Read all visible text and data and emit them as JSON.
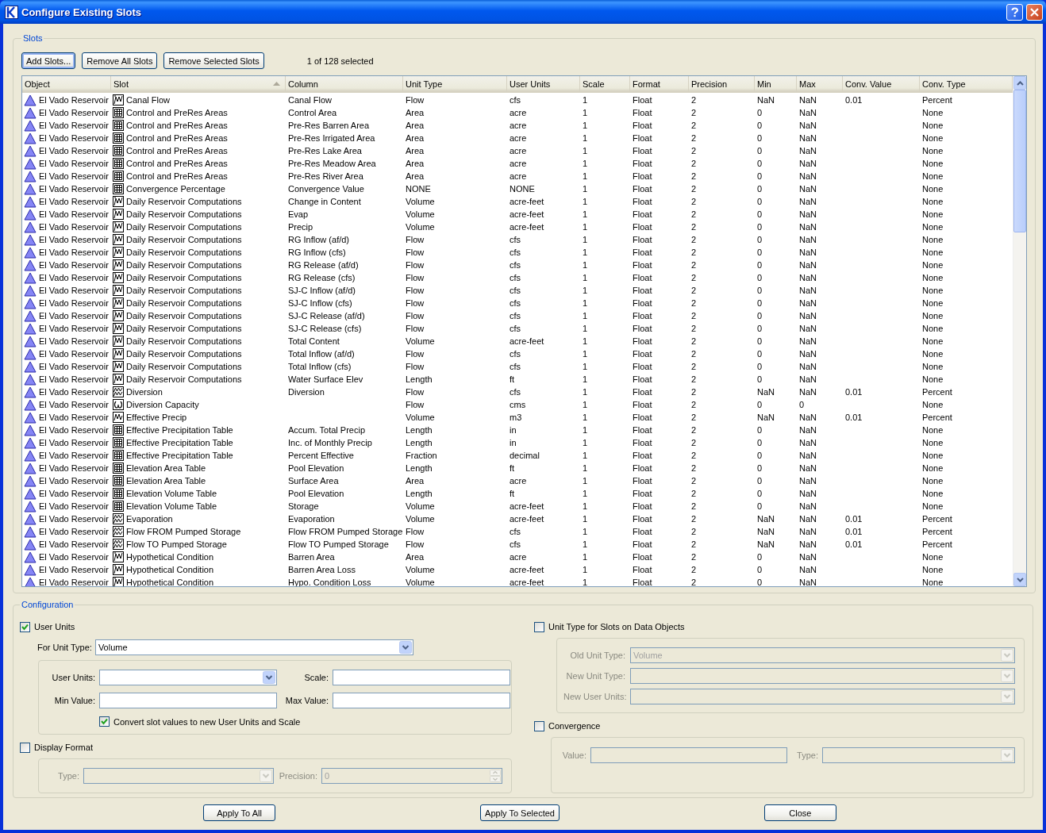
{
  "window": {
    "title": "Configure Existing Slots"
  },
  "slots": {
    "title": "Slots",
    "buttons": [
      {
        "label": "Add Slots...",
        "focused": true
      },
      {
        "label": "Remove All Slots",
        "focused": false
      },
      {
        "label": "Remove Selected Slots",
        "focused": false
      }
    ],
    "selection_count": "1 of 128 selected",
    "table": {
      "columns": [
        {
          "label": "Object",
          "sorted": false
        },
        {
          "label": "Slot",
          "sorted": true
        },
        {
          "label": "Column",
          "sorted": false
        },
        {
          "label": "Unit Type",
          "sorted": false
        },
        {
          "label": "User Units",
          "sorted": false
        },
        {
          "label": "Scale",
          "sorted": false
        },
        {
          "label": "Format",
          "sorted": false
        },
        {
          "label": "Precision",
          "sorted": false
        },
        {
          "label": "Min",
          "sorted": false
        },
        {
          "label": "Max",
          "sorted": false
        },
        {
          "label": "Conv. Value",
          "sorted": false
        },
        {
          "label": "Conv. Type",
          "sorted": false
        }
      ],
      "rows": [
        {
          "object": "El Vado Reservoir",
          "kind": "series",
          "slot": "Canal Flow",
          "column": "Canal Flow",
          "unit_type": "Flow",
          "user_units": "cfs",
          "scale": "1",
          "format": "Float",
          "precision": "2",
          "min": "NaN",
          "max": "NaN",
          "conv_value": "0.01",
          "conv_type": "Percent"
        },
        {
          "object": "El Vado Reservoir",
          "kind": "table",
          "slot": "Control and PreRes Areas",
          "column": "Control Area",
          "unit_type": "Area",
          "user_units": "acre",
          "scale": "1",
          "format": "Float",
          "precision": "2",
          "min": "0",
          "max": "NaN",
          "conv_type": "None"
        },
        {
          "object": "El Vado Reservoir",
          "kind": "table",
          "slot": "Control and PreRes Areas",
          "column": "Pre-Res Barren Area",
          "unit_type": "Area",
          "user_units": "acre",
          "scale": "1",
          "format": "Float",
          "precision": "2",
          "min": "0",
          "max": "NaN",
          "conv_type": "None"
        },
        {
          "object": "El Vado Reservoir",
          "kind": "table",
          "slot": "Control and PreRes Areas",
          "column": "Pre-Res Irrigated Area",
          "unit_type": "Area",
          "user_units": "acre",
          "scale": "1",
          "format": "Float",
          "precision": "2",
          "min": "0",
          "max": "NaN",
          "conv_type": "None"
        },
        {
          "object": "El Vado Reservoir",
          "kind": "table",
          "slot": "Control and PreRes Areas",
          "column": "Pre-Res Lake Area",
          "unit_type": "Area",
          "user_units": "acre",
          "scale": "1",
          "format": "Float",
          "precision": "2",
          "min": "0",
          "max": "NaN",
          "conv_type": "None"
        },
        {
          "object": "El Vado Reservoir",
          "kind": "table",
          "slot": "Control and PreRes Areas",
          "column": "Pre-Res Meadow Area",
          "unit_type": "Area",
          "user_units": "acre",
          "scale": "1",
          "format": "Float",
          "precision": "2",
          "min": "0",
          "max": "NaN",
          "conv_type": "None"
        },
        {
          "object": "El Vado Reservoir",
          "kind": "table",
          "slot": "Control and PreRes Areas",
          "column": "Pre-Res River Area",
          "unit_type": "Area",
          "user_units": "acre",
          "scale": "1",
          "format": "Float",
          "precision": "2",
          "min": "0",
          "max": "NaN",
          "conv_type": "None"
        },
        {
          "object": "El Vado Reservoir",
          "kind": "table",
          "slot": "Convergence Percentage",
          "column": "Convergence Value",
          "unit_type": "NONE",
          "user_units": "NONE",
          "scale": "1",
          "format": "Float",
          "precision": "2",
          "min": "0",
          "max": "NaN",
          "conv_type": "None"
        },
        {
          "object": "El Vado Reservoir",
          "kind": "series",
          "slot": "Daily Reservoir Computations",
          "column": "Change in Content",
          "unit_type": "Volume",
          "user_units": "acre-feet",
          "scale": "1",
          "format": "Float",
          "precision": "2",
          "min": "0",
          "max": "NaN",
          "conv_type": "None"
        },
        {
          "object": "El Vado Reservoir",
          "kind": "series",
          "slot": "Daily Reservoir Computations",
          "column": "Evap",
          "unit_type": "Volume",
          "user_units": "acre-feet",
          "scale": "1",
          "format": "Float",
          "precision": "2",
          "min": "0",
          "max": "NaN",
          "conv_type": "None"
        },
        {
          "object": "El Vado Reservoir",
          "kind": "series",
          "slot": "Daily Reservoir Computations",
          "column": "Precip",
          "unit_type": "Volume",
          "user_units": "acre-feet",
          "scale": "1",
          "format": "Float",
          "precision": "2",
          "min": "0",
          "max": "NaN",
          "conv_type": "None"
        },
        {
          "object": "El Vado Reservoir",
          "kind": "series",
          "slot": "Daily Reservoir Computations",
          "column": "RG Inflow (af/d)",
          "unit_type": "Flow",
          "user_units": "cfs",
          "scale": "1",
          "format": "Float",
          "precision": "2",
          "min": "0",
          "max": "NaN",
          "conv_type": "None"
        },
        {
          "object": "El Vado Reservoir",
          "kind": "series",
          "slot": "Daily Reservoir Computations",
          "column": "RG Inflow (cfs)",
          "unit_type": "Flow",
          "user_units": "cfs",
          "scale": "1",
          "format": "Float",
          "precision": "2",
          "min": "0",
          "max": "NaN",
          "conv_type": "None"
        },
        {
          "object": "El Vado Reservoir",
          "kind": "series",
          "slot": "Daily Reservoir Computations",
          "column": "RG Release (af/d)",
          "unit_type": "Flow",
          "user_units": "cfs",
          "scale": "1",
          "format": "Float",
          "precision": "2",
          "min": "0",
          "max": "NaN",
          "conv_type": "None"
        },
        {
          "object": "El Vado Reservoir",
          "kind": "series",
          "slot": "Daily Reservoir Computations",
          "column": "RG Release (cfs)",
          "unit_type": "Flow",
          "user_units": "cfs",
          "scale": "1",
          "format": "Float",
          "precision": "2",
          "min": "0",
          "max": "NaN",
          "conv_type": "None"
        },
        {
          "object": "El Vado Reservoir",
          "kind": "series",
          "slot": "Daily Reservoir Computations",
          "column": "SJ-C Inflow (af/d)",
          "unit_type": "Flow",
          "user_units": "cfs",
          "scale": "1",
          "format": "Float",
          "precision": "2",
          "min": "0",
          "max": "NaN",
          "conv_type": "None"
        },
        {
          "object": "El Vado Reservoir",
          "kind": "series",
          "slot": "Daily Reservoir Computations",
          "column": "SJ-C Inflow (cfs)",
          "unit_type": "Flow",
          "user_units": "cfs",
          "scale": "1",
          "format": "Float",
          "precision": "2",
          "min": "0",
          "max": "NaN",
          "conv_type": "None"
        },
        {
          "object": "El Vado Reservoir",
          "kind": "series",
          "slot": "Daily Reservoir Computations",
          "column": "SJ-C Release (af/d)",
          "unit_type": "Flow",
          "user_units": "cfs",
          "scale": "1",
          "format": "Float",
          "precision": "2",
          "min": "0",
          "max": "NaN",
          "conv_type": "None"
        },
        {
          "object": "El Vado Reservoir",
          "kind": "series",
          "slot": "Daily Reservoir Computations",
          "column": "SJ-C Release (cfs)",
          "unit_type": "Flow",
          "user_units": "cfs",
          "scale": "1",
          "format": "Float",
          "precision": "2",
          "min": "0",
          "max": "NaN",
          "conv_type": "None"
        },
        {
          "object": "El Vado Reservoir",
          "kind": "series",
          "slot": "Daily Reservoir Computations",
          "column": "Total Content",
          "unit_type": "Volume",
          "user_units": "acre-feet",
          "scale": "1",
          "format": "Float",
          "precision": "2",
          "min": "0",
          "max": "NaN",
          "conv_type": "None"
        },
        {
          "object": "El Vado Reservoir",
          "kind": "series",
          "slot": "Daily Reservoir Computations",
          "column": "Total Inflow (af/d)",
          "unit_type": "Flow",
          "user_units": "cfs",
          "scale": "1",
          "format": "Float",
          "precision": "2",
          "min": "0",
          "max": "NaN",
          "conv_type": "None"
        },
        {
          "object": "El Vado Reservoir",
          "kind": "series",
          "slot": "Daily Reservoir Computations",
          "column": "Total Inflow (cfs)",
          "unit_type": "Flow",
          "user_units": "cfs",
          "scale": "1",
          "format": "Float",
          "precision": "2",
          "min": "0",
          "max": "NaN",
          "conv_type": "None"
        },
        {
          "object": "El Vado Reservoir",
          "kind": "series",
          "slot": "Daily Reservoir Computations",
          "column": "Water Surface Elev",
          "unit_type": "Length",
          "user_units": "ft",
          "scale": "1",
          "format": "Float",
          "precision": "2",
          "min": "0",
          "max": "NaN",
          "conv_type": "None"
        },
        {
          "object": "El Vado Reservoir",
          "kind": "agg_series",
          "slot": "Diversion",
          "column": "Diversion",
          "unit_type": "Flow",
          "user_units": "cfs",
          "scale": "1",
          "format": "Float",
          "precision": "2",
          "min": "NaN",
          "max": "NaN",
          "conv_value": "0.01",
          "conv_type": "Percent"
        },
        {
          "object": "El Vado Reservoir",
          "kind": "scalar",
          "slot": "Diversion Capacity",
          "unit_type": "Flow",
          "user_units": "cms",
          "scale": "1",
          "format": "Float",
          "precision": "2",
          "min": "0",
          "max": "0",
          "conv_type": "None"
        },
        {
          "object": "El Vado Reservoir",
          "kind": "periodic",
          "slot": "Effective Precip",
          "unit_type": "Volume",
          "user_units": "m3",
          "scale": "1",
          "format": "Float",
          "precision": "2",
          "min": "NaN",
          "max": "NaN",
          "conv_value": "0.01",
          "conv_type": "Percent"
        },
        {
          "object": "El Vado Reservoir",
          "kind": "table",
          "slot": "Effective Precipitation Table",
          "column": "Accum. Total Precip",
          "unit_type": "Length",
          "user_units": "in",
          "scale": "1",
          "format": "Float",
          "precision": "2",
          "min": "0",
          "max": "NaN",
          "conv_type": "None"
        },
        {
          "object": "El Vado Reservoir",
          "kind": "table",
          "slot": "Effective Precipitation Table",
          "column": "Inc. of Monthly Precip",
          "unit_type": "Length",
          "user_units": "in",
          "scale": "1",
          "format": "Float",
          "precision": "2",
          "min": "0",
          "max": "NaN",
          "conv_type": "None"
        },
        {
          "object": "El Vado Reservoir",
          "kind": "table",
          "slot": "Effective Precipitation Table",
          "column": "Percent Effective",
          "unit_type": "Fraction",
          "user_units": "decimal",
          "scale": "1",
          "format": "Float",
          "precision": "2",
          "min": "0",
          "max": "NaN",
          "conv_type": "None"
        },
        {
          "object": "El Vado Reservoir",
          "kind": "table",
          "slot": "Elevation Area Table",
          "column": "Pool Elevation",
          "unit_type": "Length",
          "user_units": "ft",
          "scale": "1",
          "format": "Float",
          "precision": "2",
          "min": "0",
          "max": "NaN",
          "conv_type": "None"
        },
        {
          "object": "El Vado Reservoir",
          "kind": "table",
          "slot": "Elevation Area Table",
          "column": "Surface Area",
          "unit_type": "Area",
          "user_units": "acre",
          "scale": "1",
          "format": "Float",
          "precision": "2",
          "min": "0",
          "max": "NaN",
          "conv_type": "None"
        },
        {
          "object": "El Vado Reservoir",
          "kind": "table",
          "slot": "Elevation Volume Table",
          "column": "Pool Elevation",
          "unit_type": "Length",
          "user_units": "ft",
          "scale": "1",
          "format": "Float",
          "precision": "2",
          "min": "0",
          "max": "NaN",
          "conv_type": "None"
        },
        {
          "object": "El Vado Reservoir",
          "kind": "table",
          "slot": "Elevation Volume Table",
          "column": "Storage",
          "unit_type": "Volume",
          "user_units": "acre-feet",
          "scale": "1",
          "format": "Float",
          "precision": "2",
          "min": "0",
          "max": "NaN",
          "conv_type": "None"
        },
        {
          "object": "El Vado Reservoir",
          "kind": "agg_series",
          "slot": "Evaporation",
          "column": "Evaporation",
          "unit_type": "Volume",
          "user_units": "acre-feet",
          "scale": "1",
          "format": "Float",
          "precision": "2",
          "min": "NaN",
          "max": "NaN",
          "conv_value": "0.01",
          "conv_type": "Percent"
        },
        {
          "object": "El Vado Reservoir",
          "kind": "agg_series",
          "slot": "Flow FROM Pumped Storage",
          "column": "Flow FROM Pumped Storage",
          "unit_type": "Flow",
          "user_units": "cfs",
          "scale": "1",
          "format": "Float",
          "precision": "2",
          "min": "NaN",
          "max": "NaN",
          "conv_value": "0.01",
          "conv_type": "Percent"
        },
        {
          "object": "El Vado Reservoir",
          "kind": "agg_series",
          "slot": "Flow TO Pumped Storage",
          "column": "Flow TO Pumped Storage",
          "unit_type": "Flow",
          "user_units": "cfs",
          "scale": "1",
          "format": "Float",
          "precision": "2",
          "min": "NaN",
          "max": "NaN",
          "conv_value": "0.01",
          "conv_type": "Percent"
        },
        {
          "object": "El Vado Reservoir",
          "kind": "series",
          "slot": "Hypothetical Condition",
          "column": "Barren Area",
          "unit_type": "Area",
          "user_units": "acre",
          "scale": "1",
          "format": "Float",
          "precision": "2",
          "min": "0",
          "max": "NaN",
          "conv_type": "None"
        },
        {
          "object": "El Vado Reservoir",
          "kind": "series",
          "slot": "Hypothetical Condition",
          "column": "Barren Area Loss",
          "unit_type": "Volume",
          "user_units": "acre-feet",
          "scale": "1",
          "format": "Float",
          "precision": "2",
          "min": "0",
          "max": "NaN",
          "conv_type": "None"
        },
        {
          "object": "El Vado Reservoir",
          "kind": "series",
          "slot": "Hypothetical Condition",
          "column": "Hypo. Condition Loss",
          "unit_type": "Volume",
          "user_units": "acre-feet",
          "scale": "1",
          "format": "Float",
          "precision": "2",
          "min": "0",
          "max": "NaN",
          "conv_type": "None"
        }
      ]
    }
  },
  "configuration": {
    "title": "Configuration",
    "user_units": {
      "label": "User Units",
      "checked": true,
      "for_unit_type": {
        "label": "For Unit Type:",
        "value": "Volume",
        "disabled": false
      },
      "fields": [
        {
          "kind": "combo",
          "label": "User Units:",
          "disabled": false
        },
        {
          "kind": "text",
          "label": "Scale:",
          "disabled": false
        },
        {
          "kind": "text",
          "label": "Min Value:",
          "disabled": false
        },
        {
          "kind": "text",
          "label": "Max Value:",
          "disabled": false
        }
      ],
      "convert": {
        "label": "Convert slot values to new User Units and Scale",
        "checked": true
      }
    },
    "display_format": {
      "label": "Display Format",
      "checked": false,
      "fields": [
        {
          "kind": "combo",
          "label": "Type:",
          "disabled": true
        },
        {
          "kind": "spinner",
          "label": "Precision:",
          "value": "0",
          "disabled": true
        }
      ]
    },
    "unit_type_for_slots": {
      "label": "Unit Type for Slots on Data Objects",
      "checked": false,
      "fields": [
        {
          "kind": "combo",
          "label": "Old Unit Type:",
          "value": "Volume",
          "disabled": true
        },
        {
          "kind": "combo",
          "label": "New Unit Type:",
          "disabled": true
        },
        {
          "kind": "combo",
          "label": "New User Units:",
          "disabled": true
        }
      ]
    },
    "convergence": {
      "label": "Convergence",
      "checked": false,
      "fields": [
        {
          "kind": "text",
          "label": "Value:",
          "disabled": true
        },
        {
          "kind": "combo",
          "label": "Type:",
          "disabled": true
        }
      ]
    }
  },
  "buttons": [
    {
      "label": "Apply To All"
    },
    {
      "label": "Apply To Selected"
    },
    {
      "label": "Close"
    }
  ]
}
